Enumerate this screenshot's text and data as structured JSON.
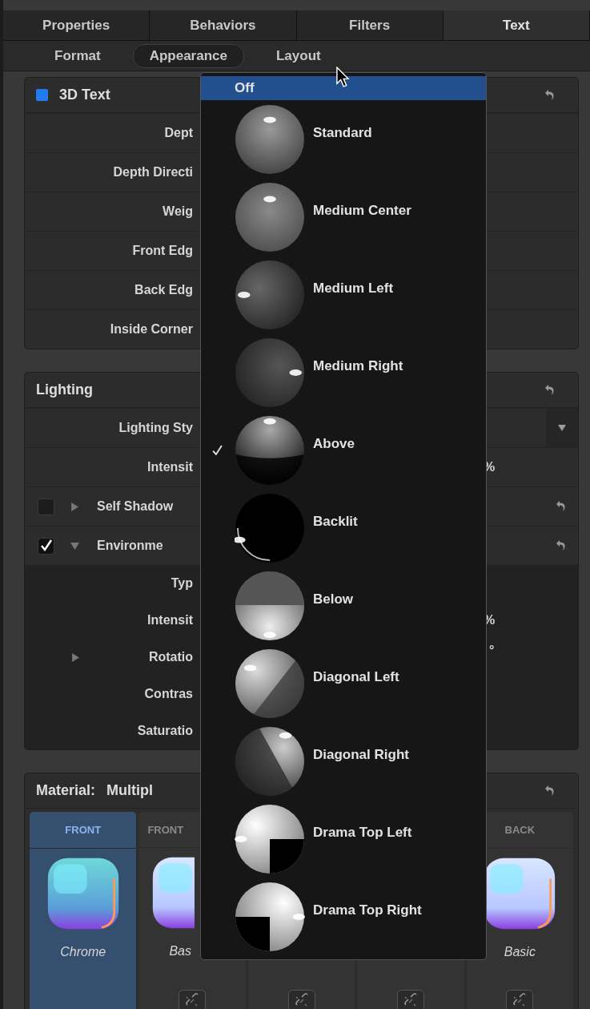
{
  "tabs": [
    {
      "label": "Properties",
      "selected": false
    },
    {
      "label": "Behaviors",
      "selected": false
    },
    {
      "label": "Filters",
      "selected": false
    },
    {
      "label": "Text",
      "selected": true
    }
  ],
  "subtabs": [
    {
      "label": "Format",
      "selected": false
    },
    {
      "label": "Appearance",
      "selected": true
    },
    {
      "label": "Layout",
      "selected": false
    }
  ],
  "text_3d": {
    "title": "3D Text",
    "enabled": true,
    "rows": [
      {
        "label": "Dept"
      },
      {
        "label": "Depth Directi"
      },
      {
        "label": "Weig"
      },
      {
        "label": "Front Edg"
      },
      {
        "label": "Back Edg"
      },
      {
        "label": "Inside Corner"
      }
    ]
  },
  "lighting": {
    "title": "Lighting",
    "rows": [
      {
        "kind": "dropdown",
        "label": "Lighting Sty"
      },
      {
        "kind": "value",
        "label": "Intensit",
        "value": "%"
      },
      {
        "kind": "toggle",
        "label": "Self Shadow",
        "checked": false,
        "expanded": false
      },
      {
        "kind": "toggle",
        "label": "Environme",
        "checked": true,
        "expanded": true,
        "children": [
          {
            "kind": "plain",
            "label": "Typ"
          },
          {
            "kind": "value",
            "label": "Intensit",
            "value": "%"
          },
          {
            "kind": "disclosure",
            "label": "Rotatio",
            "value": "°",
            "expanded": false
          },
          {
            "kind": "plain",
            "label": "Contras"
          },
          {
            "kind": "plain",
            "label": "Saturatio"
          }
        ]
      }
    ]
  },
  "material": {
    "title": "Material:",
    "value": "Multipl",
    "cards": [
      {
        "label": "FRONT",
        "name": "Chrome",
        "selected": true,
        "link": false
      },
      {
        "label": "FRONT",
        "name": "Bas",
        "selected": false,
        "link": true
      },
      {
        "selected": false,
        "link": true
      },
      {
        "selected": false,
        "link": true
      },
      {
        "label": "BACK",
        "name": "Basic",
        "selected": false,
        "link": true
      }
    ]
  },
  "menu": {
    "items": [
      {
        "kind": "text",
        "label": "Off",
        "highlighted": true,
        "selected": false
      },
      {
        "kind": "sphere",
        "label": "Standard",
        "highlighted": false,
        "selected": false
      },
      {
        "kind": "sphere",
        "label": "Medium Center",
        "highlighted": false,
        "selected": false
      },
      {
        "kind": "sphere",
        "label": "Medium Left",
        "highlighted": false,
        "selected": false
      },
      {
        "kind": "sphere",
        "label": "Medium Right",
        "highlighted": false,
        "selected": false
      },
      {
        "kind": "sphere",
        "label": "Above",
        "highlighted": false,
        "selected": true
      },
      {
        "kind": "sphere",
        "label": "Backlit",
        "highlighted": false,
        "selected": false
      },
      {
        "kind": "sphere",
        "label": "Below",
        "highlighted": false,
        "selected": false
      },
      {
        "kind": "sphere",
        "label": "Diagonal Left",
        "highlighted": false,
        "selected": false
      },
      {
        "kind": "sphere",
        "label": "Diagonal Right",
        "highlighted": false,
        "selected": false
      },
      {
        "kind": "sphere",
        "label": "Drama Top Left",
        "highlighted": false,
        "selected": false
      },
      {
        "kind": "sphere",
        "label": "Drama Top Right",
        "highlighted": false,
        "selected": false
      }
    ]
  }
}
